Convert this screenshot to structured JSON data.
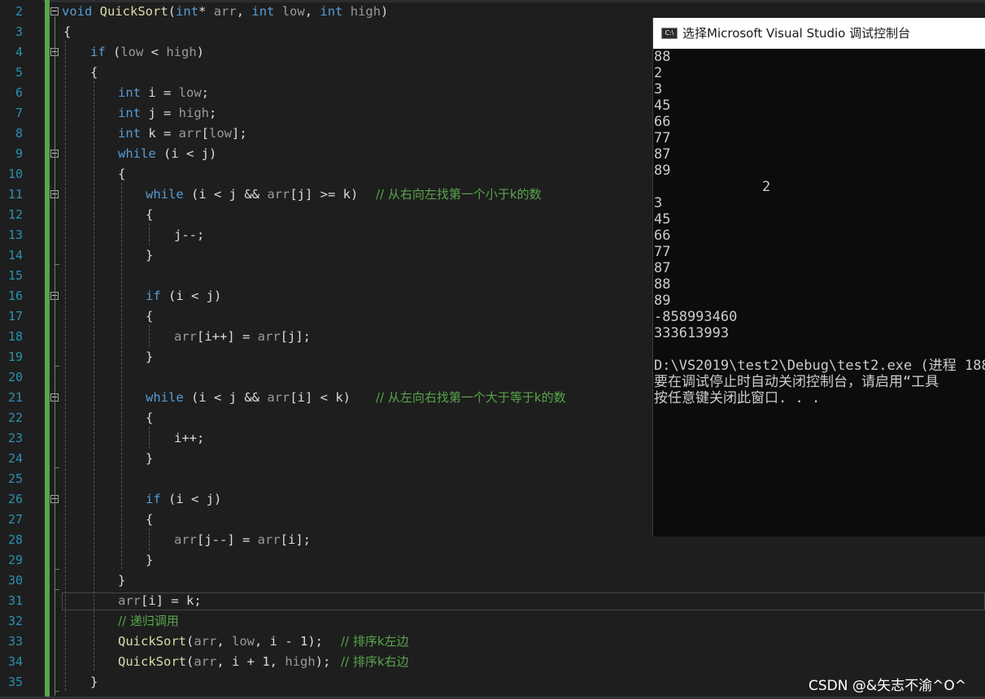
{
  "editor": {
    "line_numbers": [
      "2",
      "3",
      "4",
      "5",
      "6",
      "7",
      "8",
      "9",
      "10",
      "11",
      "12",
      "13",
      "14",
      "15",
      "16",
      "17",
      "18",
      "19",
      "20",
      "21",
      "22",
      "23",
      "24",
      "25",
      "26",
      "27",
      "28",
      "29",
      "30",
      "31",
      "32",
      "33",
      "34",
      "35"
    ],
    "code": {
      "l2": {
        "kw1": "void",
        "fn": "QuickSort",
        "p1": "(",
        "kw2": "int",
        "p2": "* ",
        "pm1": "arr",
        "p3": ", ",
        "kw3": "int",
        "p4": " ",
        "pm2": "low",
        "p5": ", ",
        "kw4": "int",
        "p6": " ",
        "pm3": "high",
        "p7": ")"
      },
      "l3": "{",
      "l4": {
        "kw": "if",
        "rest1": " (",
        "pm1": "low",
        "op": " < ",
        "pm2": "high",
        "rest2": ")"
      },
      "l5": "{",
      "l6": {
        "kw": "int",
        "v": " i",
        "rest": " = ",
        "pm": "low",
        "end": ";"
      },
      "l7": {
        "kw": "int",
        "v": " j",
        "rest": " = ",
        "pm": "high",
        "end": ";"
      },
      "l8": {
        "kw": "int",
        "v": " k",
        "rest": " = ",
        "pm": "arr",
        "rest2": "[",
        "pm2": "low",
        "end": "];"
      },
      "l9": {
        "kw": "while",
        "rest": " (i < j)"
      },
      "l10": "{",
      "l11": {
        "kw": "while",
        "rest": " (i < j && ",
        "pm": "arr",
        "rest2": "[j] >= k)",
        "comment": "// 从右向左找第一个小于k的数"
      },
      "l12": "{",
      "l13": "j--;",
      "l14": "}",
      "l16": {
        "kw": "if",
        "rest": " (i < j)"
      },
      "l17": "{",
      "l18": {
        "pm1": "arr",
        "rest1": "[i++] = ",
        "pm2": "arr",
        "rest2": "[j];"
      },
      "l19": "}",
      "l21": {
        "kw": "while",
        "rest": " (i < j && ",
        "pm": "arr",
        "rest2": "[i] < k)",
        "comment": "// 从左向右找第一个大于等于k的数"
      },
      "l22": "{",
      "l23": "i++;",
      "l24": "}",
      "l26": {
        "kw": "if",
        "rest": " (i < j)"
      },
      "l27": "{",
      "l28": {
        "pm1": "arr",
        "rest1": "[j--] = ",
        "pm2": "arr",
        "rest2": "[i];"
      },
      "l29": "}",
      "l30": "}",
      "l31": {
        "pm": "arr",
        "rest": "[i] = k;"
      },
      "l32": "// 递归调用",
      "l33": {
        "fn": "QuickSort",
        "p1": "(",
        "pm1": "arr",
        "p2": ", ",
        "pm2": "low",
        "p3": ", i - 1);",
        "comment": "// 排序k左边"
      },
      "l34": {
        "fn": "QuickSort",
        "p1": "(",
        "pm1": "arr",
        "p2": ", i + 1, ",
        "pm2": "high",
        "p3": ");",
        "comment": "// 排序k右边"
      },
      "l35": "}"
    }
  },
  "console": {
    "title": "选择Microsoft Visual Studio 调试控制台",
    "icon": "console-app-icon",
    "icon_label": "C:\\",
    "lines": [
      "88",
      "2",
      "3",
      "45",
      "66",
      "77",
      "87",
      "89",
      "             2",
      "3",
      "45",
      "66",
      "77",
      "87",
      "88",
      "89",
      "-858993460",
      "333613993",
      "",
      "D:\\VS2019\\test2\\Debug\\test2.exe (进程 188",
      "要在调试停止时自动关闭控制台，请启用“工具",
      "按任意键关闭此窗口. . ."
    ]
  },
  "watermark": "CSDN @&矢志不渝^O^",
  "colors": {
    "keyword": "#569cd6",
    "function": "#dcdcaa",
    "comment": "#57a64a",
    "line_number": "#2b91af",
    "background": "#1e1e1e",
    "console_bg": "#0c0c0c"
  }
}
